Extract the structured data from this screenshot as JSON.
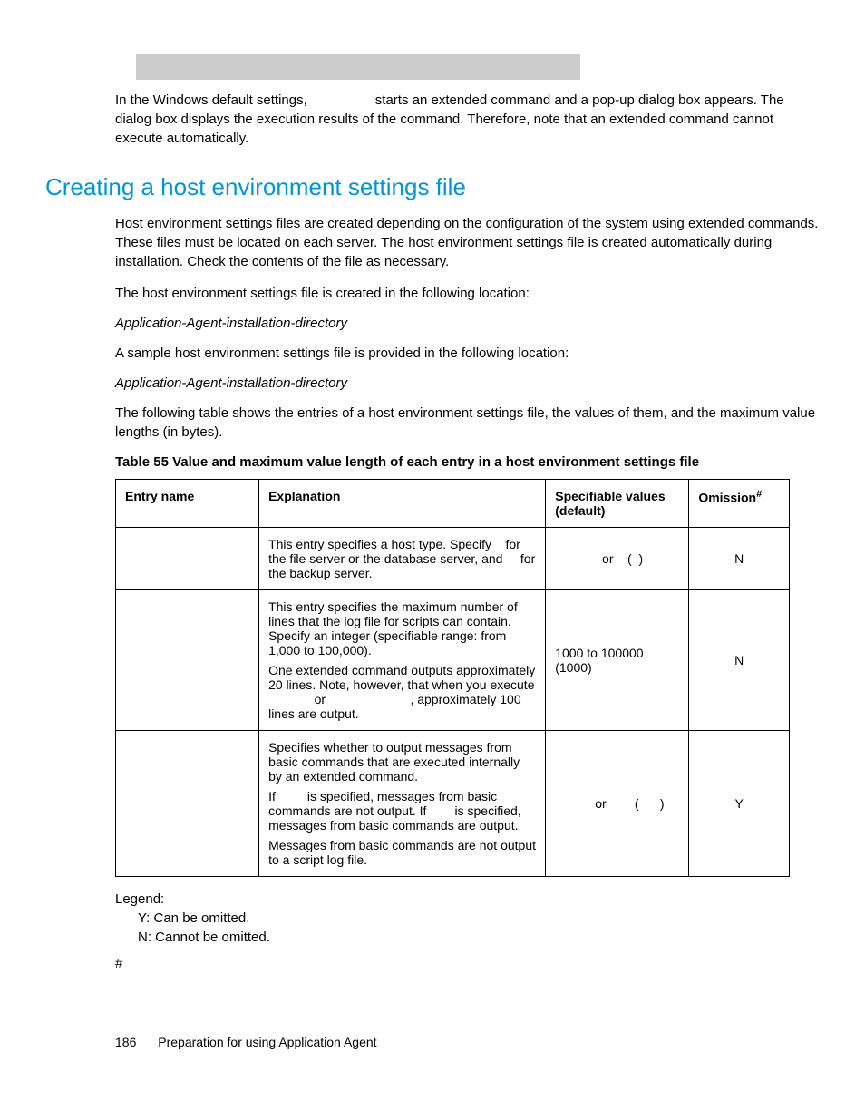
{
  "intro": {
    "codeblock": " ",
    "para": "In the Windows default settings,                  starts an extended command and a pop-up dialog box appears. The dialog box displays the execution results of the command. Therefore, note that an extended command cannot execute automatically."
  },
  "heading": "Creating a host environment settings file",
  "p1": "Host environment settings files are created depending on the configuration of the system using extended commands. These files must be located on each server. The host environment settings file is created automatically during installation. Check the contents of the file as necessary.",
  "p2": "The host environment settings file is created in the following location:",
  "p3": "Application-Agent-installation-directory",
  "p4": "A sample host environment settings file is provided in the following location:",
  "p5": "Application-Agent-installation-directory",
  "p6": "The following table shows the entries of a host environment settings file, the values of them, and the maximum value lengths (in bytes).",
  "table_caption": "Table 55 Value and maximum value length of each entry in a host environment settings file",
  "headers": {
    "c1": "Entry name",
    "c2": "Explanation",
    "c3": "Specifiable values (default)",
    "c4": "Omission",
    "c4sup": "#"
  },
  "rows": [
    {
      "entry": "",
      "explanation": "This entry specifies a host type. Specify    for the file server or the database server, and     for the backup server.",
      "values": "   or    (  )",
      "omission": "N"
    },
    {
      "entry": "",
      "explanation_p1": "This entry specifies the maximum number of lines that the log file for scripts can contain. Specify an integer (specifiable range: from 1,000 to 100,000).",
      "explanation_p2": "One extended command outputs approximately 20 lines. Note, however, that when you execute              or                        , approximately 100 lines are output.",
      "values": "1000 to 100000 (1000)",
      "omission": "N"
    },
    {
      "entry": "",
      "explanation_p1": "Specifies whether to output messages from basic commands that are executed internally by an extended command.",
      "explanation_p2": "If         is specified, messages from basic commands are not output. If        is specified, messages from basic commands are output.",
      "explanation_p3": "Messages from basic commands are not output to a script log file.",
      "values": "       or        (      )",
      "omission": "Y"
    }
  ],
  "legend": {
    "title": "Legend:",
    "y": "Y: Can be omitted.",
    "n": "N: Cannot be omitted."
  },
  "hash": "#",
  "footer": {
    "page": "186",
    "title": "Preparation for using Application Agent"
  }
}
